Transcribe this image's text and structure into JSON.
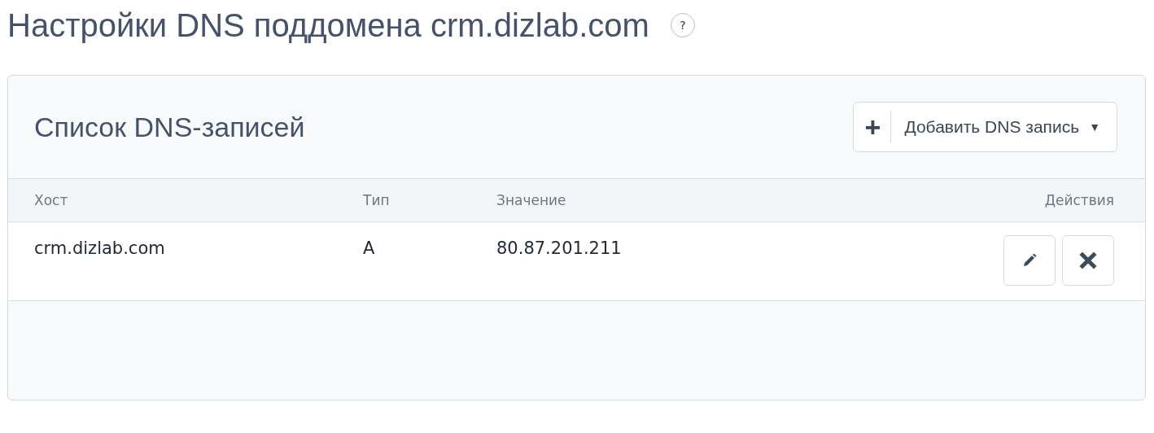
{
  "page": {
    "title": "Настройки DNS поддомена crm.dizlab.com",
    "help": "?"
  },
  "panel": {
    "title": "Список DNS-записей",
    "add_button": {
      "icon": "+",
      "label": "Добавить DNS запись",
      "caret": "▼"
    }
  },
  "table": {
    "columns": [
      "Хост",
      "Тип",
      "Значение",
      "Действия"
    ],
    "rows": [
      {
        "host": "crm.dizlab.com",
        "type": "A",
        "value": "80.87.201.211"
      }
    ]
  }
}
